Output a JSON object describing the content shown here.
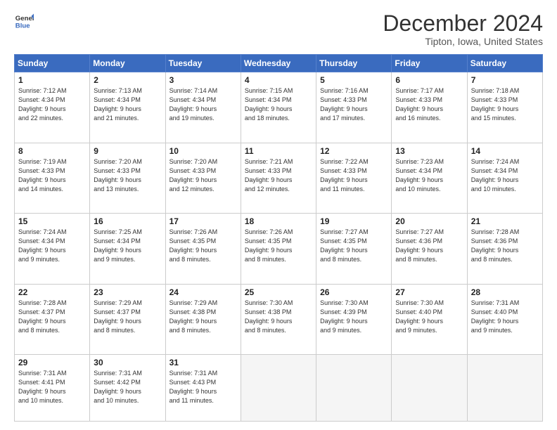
{
  "header": {
    "logo_line1": "General",
    "logo_line2": "Blue",
    "title": "December 2024",
    "location": "Tipton, Iowa, United States"
  },
  "days_of_week": [
    "Sunday",
    "Monday",
    "Tuesday",
    "Wednesday",
    "Thursday",
    "Friday",
    "Saturday"
  ],
  "weeks": [
    [
      {
        "day": "1",
        "info": "Sunrise: 7:12 AM\nSunset: 4:34 PM\nDaylight: 9 hours\nand 22 minutes."
      },
      {
        "day": "2",
        "info": "Sunrise: 7:13 AM\nSunset: 4:34 PM\nDaylight: 9 hours\nand 21 minutes."
      },
      {
        "day": "3",
        "info": "Sunrise: 7:14 AM\nSunset: 4:34 PM\nDaylight: 9 hours\nand 19 minutes."
      },
      {
        "day": "4",
        "info": "Sunrise: 7:15 AM\nSunset: 4:34 PM\nDaylight: 9 hours\nand 18 minutes."
      },
      {
        "day": "5",
        "info": "Sunrise: 7:16 AM\nSunset: 4:33 PM\nDaylight: 9 hours\nand 17 minutes."
      },
      {
        "day": "6",
        "info": "Sunrise: 7:17 AM\nSunset: 4:33 PM\nDaylight: 9 hours\nand 16 minutes."
      },
      {
        "day": "7",
        "info": "Sunrise: 7:18 AM\nSunset: 4:33 PM\nDaylight: 9 hours\nand 15 minutes."
      }
    ],
    [
      {
        "day": "8",
        "info": "Sunrise: 7:19 AM\nSunset: 4:33 PM\nDaylight: 9 hours\nand 14 minutes."
      },
      {
        "day": "9",
        "info": "Sunrise: 7:20 AM\nSunset: 4:33 PM\nDaylight: 9 hours\nand 13 minutes."
      },
      {
        "day": "10",
        "info": "Sunrise: 7:20 AM\nSunset: 4:33 PM\nDaylight: 9 hours\nand 12 minutes."
      },
      {
        "day": "11",
        "info": "Sunrise: 7:21 AM\nSunset: 4:33 PM\nDaylight: 9 hours\nand 12 minutes."
      },
      {
        "day": "12",
        "info": "Sunrise: 7:22 AM\nSunset: 4:33 PM\nDaylight: 9 hours\nand 11 minutes."
      },
      {
        "day": "13",
        "info": "Sunrise: 7:23 AM\nSunset: 4:34 PM\nDaylight: 9 hours\nand 10 minutes."
      },
      {
        "day": "14",
        "info": "Sunrise: 7:24 AM\nSunset: 4:34 PM\nDaylight: 9 hours\nand 10 minutes."
      }
    ],
    [
      {
        "day": "15",
        "info": "Sunrise: 7:24 AM\nSunset: 4:34 PM\nDaylight: 9 hours\nand 9 minutes."
      },
      {
        "day": "16",
        "info": "Sunrise: 7:25 AM\nSunset: 4:34 PM\nDaylight: 9 hours\nand 9 minutes."
      },
      {
        "day": "17",
        "info": "Sunrise: 7:26 AM\nSunset: 4:35 PM\nDaylight: 9 hours\nand 8 minutes."
      },
      {
        "day": "18",
        "info": "Sunrise: 7:26 AM\nSunset: 4:35 PM\nDaylight: 9 hours\nand 8 minutes."
      },
      {
        "day": "19",
        "info": "Sunrise: 7:27 AM\nSunset: 4:35 PM\nDaylight: 9 hours\nand 8 minutes."
      },
      {
        "day": "20",
        "info": "Sunrise: 7:27 AM\nSunset: 4:36 PM\nDaylight: 9 hours\nand 8 minutes."
      },
      {
        "day": "21",
        "info": "Sunrise: 7:28 AM\nSunset: 4:36 PM\nDaylight: 9 hours\nand 8 minutes."
      }
    ],
    [
      {
        "day": "22",
        "info": "Sunrise: 7:28 AM\nSunset: 4:37 PM\nDaylight: 9 hours\nand 8 minutes."
      },
      {
        "day": "23",
        "info": "Sunrise: 7:29 AM\nSunset: 4:37 PM\nDaylight: 9 hours\nand 8 minutes."
      },
      {
        "day": "24",
        "info": "Sunrise: 7:29 AM\nSunset: 4:38 PM\nDaylight: 9 hours\nand 8 minutes."
      },
      {
        "day": "25",
        "info": "Sunrise: 7:30 AM\nSunset: 4:38 PM\nDaylight: 9 hours\nand 8 minutes."
      },
      {
        "day": "26",
        "info": "Sunrise: 7:30 AM\nSunset: 4:39 PM\nDaylight: 9 hours\nand 9 minutes."
      },
      {
        "day": "27",
        "info": "Sunrise: 7:30 AM\nSunset: 4:40 PM\nDaylight: 9 hours\nand 9 minutes."
      },
      {
        "day": "28",
        "info": "Sunrise: 7:31 AM\nSunset: 4:40 PM\nDaylight: 9 hours\nand 9 minutes."
      }
    ],
    [
      {
        "day": "29",
        "info": "Sunrise: 7:31 AM\nSunset: 4:41 PM\nDaylight: 9 hours\nand 10 minutes."
      },
      {
        "day": "30",
        "info": "Sunrise: 7:31 AM\nSunset: 4:42 PM\nDaylight: 9 hours\nand 10 minutes."
      },
      {
        "day": "31",
        "info": "Sunrise: 7:31 AM\nSunset: 4:43 PM\nDaylight: 9 hours\nand 11 minutes."
      },
      {
        "day": "",
        "info": ""
      },
      {
        "day": "",
        "info": ""
      },
      {
        "day": "",
        "info": ""
      },
      {
        "day": "",
        "info": ""
      }
    ]
  ]
}
